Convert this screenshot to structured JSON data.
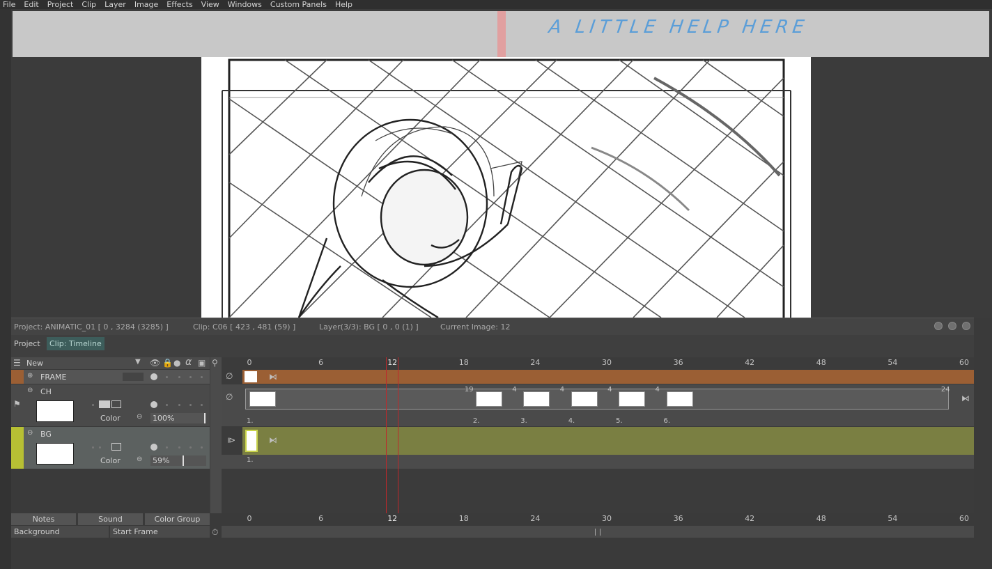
{
  "menu": [
    "File",
    "Edit",
    "Project",
    "Clip",
    "Layer",
    "Image",
    "Effects",
    "View",
    "Windows",
    "Custom Panels",
    "Help"
  ],
  "viewer": {
    "note_text": "A LITTLE HELP HERE"
  },
  "timeline": {
    "info": {
      "project": "Project: ANIMATIC_01 [ 0 , 3284  (3285) ]",
      "clip": "Clip: C06 [ 423 , 481  (59) ]",
      "layer": "Layer(3/3): BG [ 0 , 0  (1) ]",
      "current_image": "Current Image: 12"
    },
    "tabs": [
      "Project",
      "Clip: Timeline"
    ],
    "new_label": "New",
    "ruler": [
      "0",
      "6",
      "12",
      "18",
      "24",
      "30",
      "36",
      "42",
      "48",
      "54",
      "60"
    ],
    "current_frame": 12,
    "layers": [
      {
        "name": "FRAME",
        "color": "#9b5f34"
      },
      {
        "name": "CH",
        "color_label": "Color",
        "opacity": "100%",
        "opacity_value": 1.0
      },
      {
        "name": "BG",
        "color_label": "Color",
        "opacity": "59%",
        "opacity_value": 0.59,
        "color": "#7a7f42"
      }
    ],
    "ch_cels": [
      {
        "label": "1.",
        "frame": 0,
        "length": "19"
      },
      {
        "label": "2.",
        "frame": 19,
        "length": "4"
      },
      {
        "label": "3.",
        "frame": 23,
        "length": "4"
      },
      {
        "label": "4.",
        "frame": 27,
        "length": "4"
      },
      {
        "label": "5.",
        "frame": 31,
        "length": "4"
      },
      {
        "label": "6.",
        "frame": 35,
        "length": "24"
      }
    ],
    "bg_cel_label": "1.",
    "bottom_tabs": [
      "Notes",
      "Sound",
      "Color Group"
    ],
    "bottom_selects": [
      "Background",
      "Start Frame"
    ]
  },
  "icons": [
    "eye-icon",
    "lock-icon",
    "bulb-icon",
    "alpha-icon",
    "mask-icon",
    "zoom-icon",
    "stopwatch-icon",
    "layers-icon",
    "tag-icon"
  ]
}
